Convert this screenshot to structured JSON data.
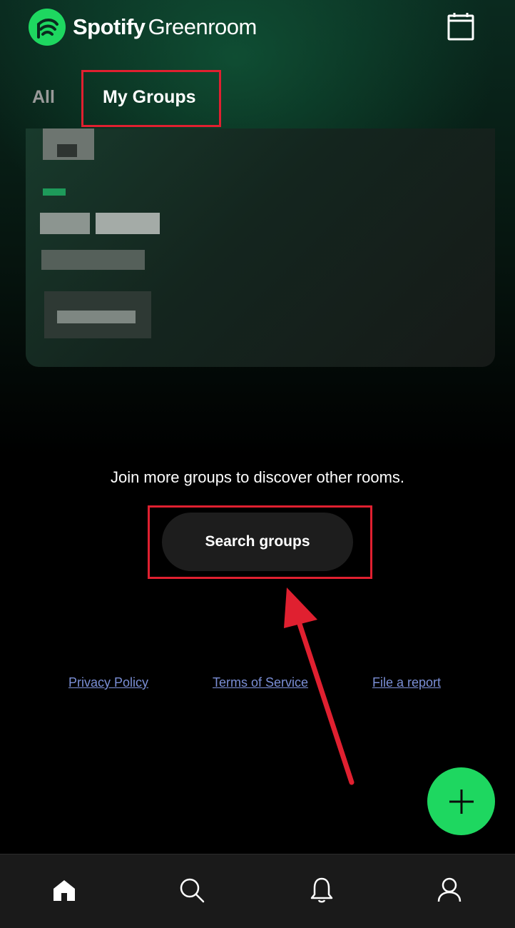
{
  "app": {
    "brand_bold": "Spotify",
    "brand_light": "Greenroom",
    "accent_color": "#1ed760",
    "highlight_color": "#e02030",
    "link_color": "#7b8fd6"
  },
  "header": {
    "calendar_icon": "calendar-icon"
  },
  "tabs": [
    {
      "label": "All",
      "active": false
    },
    {
      "label": "My Groups",
      "active": true
    }
  ],
  "main": {
    "empty_message": "Join more groups to discover other rooms.",
    "search_button_label": "Search groups"
  },
  "footer": {
    "links": [
      {
        "label": "Privacy Policy"
      },
      {
        "label": "Terms of Service"
      },
      {
        "label": "File a report"
      }
    ]
  },
  "fab": {
    "icon": "plus-icon"
  },
  "bottom_nav": [
    {
      "icon": "home-icon",
      "active": true
    },
    {
      "icon": "search-icon",
      "active": false
    },
    {
      "icon": "bell-icon",
      "active": false
    },
    {
      "icon": "profile-icon",
      "active": false
    }
  ]
}
